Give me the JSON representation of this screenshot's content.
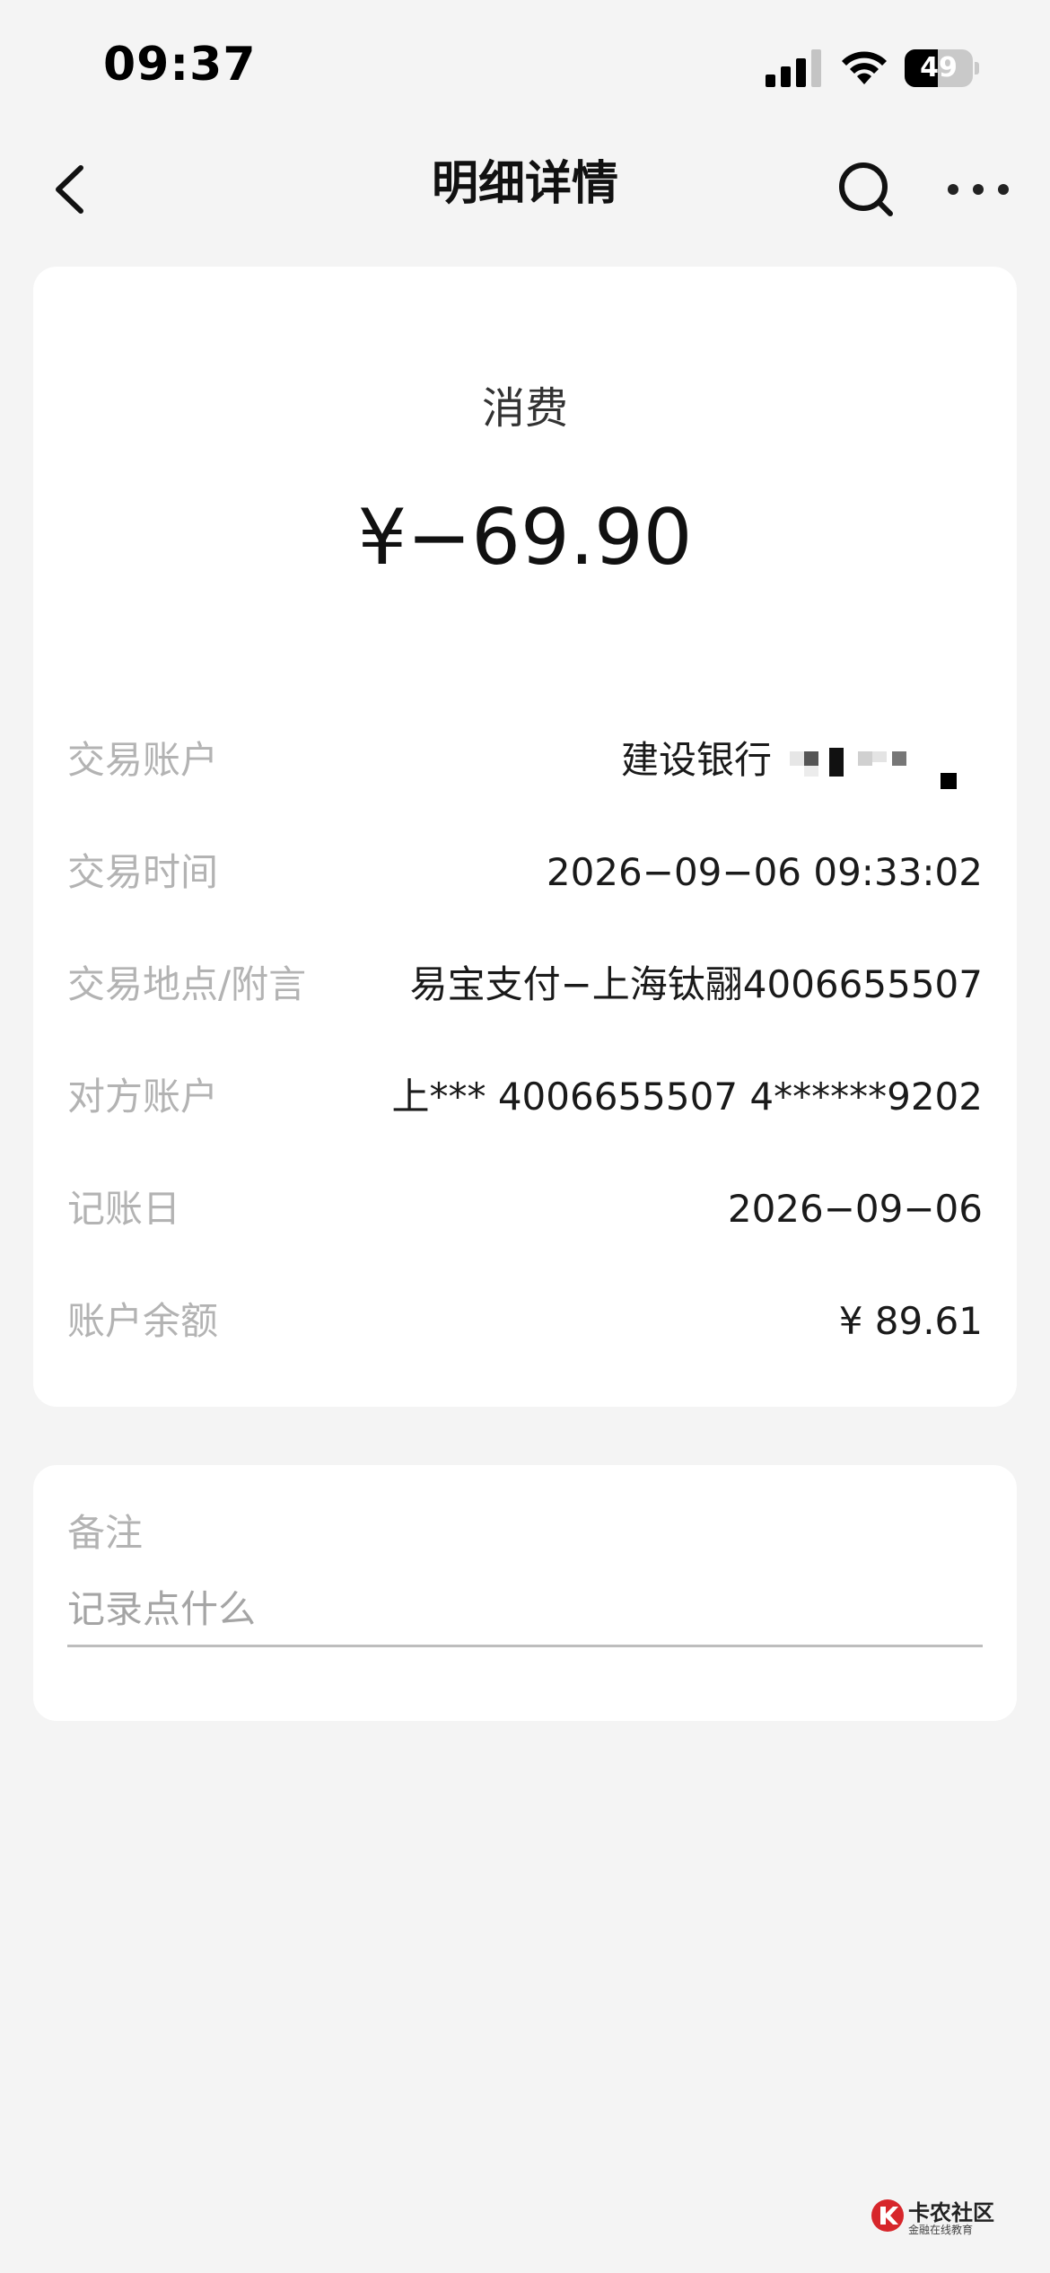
{
  "status_bar": {
    "time": "09:37",
    "battery_level": 49,
    "battery_text": "49"
  },
  "nav": {
    "title": "明细详情",
    "icons": [
      "chevron-left-icon",
      "search-icon",
      "more-icon"
    ]
  },
  "transaction": {
    "type": "消费",
    "amount": "¥−69.90",
    "details": [
      {
        "label": "交易账户",
        "value": "建设银行"
      },
      {
        "label": "交易时间",
        "value": "2026−09−06 09:33:02"
      },
      {
        "label": "交易地点/附言",
        "value": "易宝支付−上海钛翮4006655507"
      },
      {
        "label": "对方账户",
        "value": "上*** 4006655507 4******9202"
      },
      {
        "label": "记账日",
        "value": "2026−09−06"
      },
      {
        "label": "账户余额",
        "value": "¥ 89.61"
      }
    ]
  },
  "note": {
    "title": "备注",
    "placeholder": "记录点什么"
  },
  "watermark": {
    "title": "卡农社区",
    "subtitle": "金融在线教育"
  }
}
